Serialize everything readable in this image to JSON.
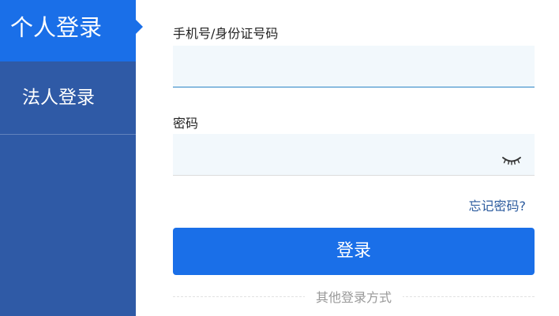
{
  "sidebar": {
    "tabs": [
      {
        "label": "个人登录",
        "active": true
      },
      {
        "label": "法人登录",
        "active": false
      }
    ]
  },
  "form": {
    "id_label": "手机号/身份证号码",
    "id_value": "",
    "password_label": "密码",
    "password_value": "",
    "password_toggle_icon": "eye-closed-icon",
    "forgot_link": "忘记密码?",
    "login_button": "登录",
    "other_methods": "其他登录方式"
  },
  "colors": {
    "sidebar_bg": "#2f5aa6",
    "active_tab_bg": "#1a6fe8",
    "primary_button": "#1a6fe8",
    "input_bg": "#f2f8fc",
    "link": "#2c5b9e"
  }
}
